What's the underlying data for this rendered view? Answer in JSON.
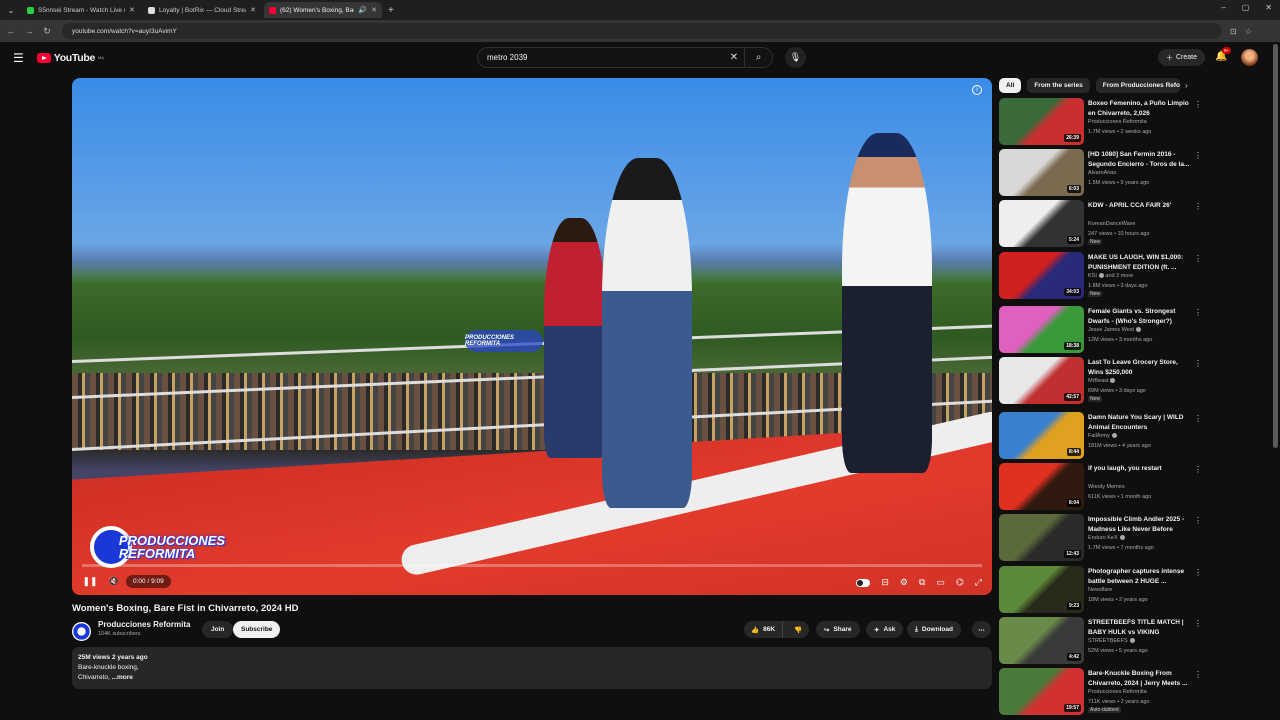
{
  "browser": {
    "tabs": [
      {
        "title": "S5nnsei Stream - Watch Live or",
        "favicon_color": "#2ecc40",
        "active": false
      },
      {
        "title": "Loyalty | BotRix — Cloud Stream",
        "favicon_color": "#dddddd",
        "active": false
      },
      {
        "title": "(62) Women's Boxing, Bare",
        "favicon_color": "#ff0033",
        "active": true
      }
    ],
    "url": "youtube.com/watch?v=auyI3uAvimY"
  },
  "header": {
    "logo_text": "YouTube",
    "logo_region": "MA",
    "search_value": "metro 2039",
    "create_label": "Create",
    "notif_count": "9+"
  },
  "player": {
    "watermark_text": "PRODUCCIONES REFORMITA",
    "time": "0:00 / 9:09",
    "progress": 0.0
  },
  "video": {
    "title": "Women's Boxing, Bare Fist in Chivarreto, 2024 HD",
    "channel": "Producciones  Reformita",
    "subscribers": "104K subscribers",
    "join_label": "Join",
    "subscribe_label": "Subscribe",
    "likes": "86K",
    "share_label": "Share",
    "ask_label": "Ask",
    "download_label": "Download",
    "desc_meta": "25M views  2 years ago",
    "desc_line1": "Bare-knuckle boxing,",
    "desc_line2": "Chivarreto,",
    "desc_more": " ...more"
  },
  "sidebar": {
    "chips": [
      "All",
      "From the series",
      "From Producciones Reformita"
    ],
    "items": [
      {
        "title": "Boxeo Femenino, a Puño Limpio en Chivarreto,  2,026",
        "channel": "Producciones Reformita",
        "verified": false,
        "meta": "1.7M views • 2 weeks ago",
        "duration": "26:39",
        "badge": "",
        "color_a": "#3a6a3a",
        "color_b": "#c83030"
      },
      {
        "title": "[HD 1080] San Fermin 2016 - Segundo Encierro - Toros de la...",
        "channel": "AlvaroArias",
        "verified": false,
        "meta": "1.5M views • 9 years ago",
        "duration": "6:03",
        "badge": "",
        "color_a": "#d8d8d8",
        "color_b": "#7a6a50"
      },
      {
        "title": "KDW - APRIL CCA FAIR 26'",
        "channel": "KoreanDanceWave",
        "verified": false,
        "meta": "247 views • 10 hours ago",
        "duration": "5:24",
        "badge": "New",
        "color_a": "#eeeeee",
        "color_b": "#333333"
      },
      {
        "title": "MAKE US LAUGH, WIN $1,000: PUNISHMENT EDITION (ft. ...",
        "channel": "KSI",
        "verified": true,
        "channel_suffix": " and 2 more",
        "meta": "1.8M views • 3 days ago",
        "duration": "34:03",
        "badge": "New",
        "color_a": "#d02020",
        "color_b": "#2a2a7a"
      },
      {
        "title": "Female Giants vs. Strongest Dwarfs - (Who's Stronger?)",
        "channel": "Jesse James West",
        "verified": true,
        "meta": "12M views • 3 months ago",
        "duration": "18:38",
        "badge": "",
        "color_a": "#e060c0",
        "color_b": "#3a9a3a"
      },
      {
        "title": "Last To Leave Grocery Store, Wins $250,000",
        "channel": "MrBeast",
        "verified": true,
        "meta": "69M views • 3 days ago",
        "duration": "42:57",
        "badge": "New",
        "color_a": "#e8e8e8",
        "color_b": "#c03030"
      },
      {
        "title": "Damn Nature You Scary | WILD Animal Encounters",
        "channel": "FailArmy",
        "verified": true,
        "meta": "181M views • 4 years ago",
        "duration": "8:44",
        "badge": "",
        "color_a": "#3a80d0",
        "color_b": "#e0a020"
      },
      {
        "title": "if you laugh, you restart",
        "channel": "Woody Memes",
        "verified": false,
        "meta": "611K views • 1 month ago",
        "duration": "8:04",
        "badge": "",
        "color_a": "#e03020",
        "color_b": "#301a10"
      },
      {
        "title": "Impossible Climb Andler 2025 - Madness Like Never Before",
        "channel": "Enduro KeX",
        "verified": true,
        "meta": "1.7M views • 7 months ago",
        "duration": "12:43",
        "badge": "",
        "color_a": "#5a6a3a",
        "color_b": "#2a2a2a"
      },
      {
        "title": "Photographer captures intense battle between 2 HUGE ...",
        "channel": "Newsflare",
        "verified": false,
        "meta": "18M views • 2 years ago",
        "duration": "9:23",
        "badge": "",
        "color_a": "#5a8a3a",
        "color_b": "#2a2a1a"
      },
      {
        "title": "STREETBEEFS TITLE MATCH | BABY HULK vs VIKING",
        "channel": "STREETBEEFS",
        "verified": true,
        "meta": "52M views • 5 years ago",
        "duration": "4:42",
        "badge": "",
        "color_a": "#6a8a4a",
        "color_b": "#3a3a3a"
      },
      {
        "title": "Bare-Knuckle Boxing From Chivarreto, 2024 | Jerry Meets ...",
        "channel": "Producciones Reformita",
        "verified": false,
        "meta": "711K views • 2 years ago",
        "duration": "19:57",
        "badge": "Auto-dubbed",
        "color_a": "#4a7a3a",
        "color_b": "#d03030"
      }
    ]
  }
}
